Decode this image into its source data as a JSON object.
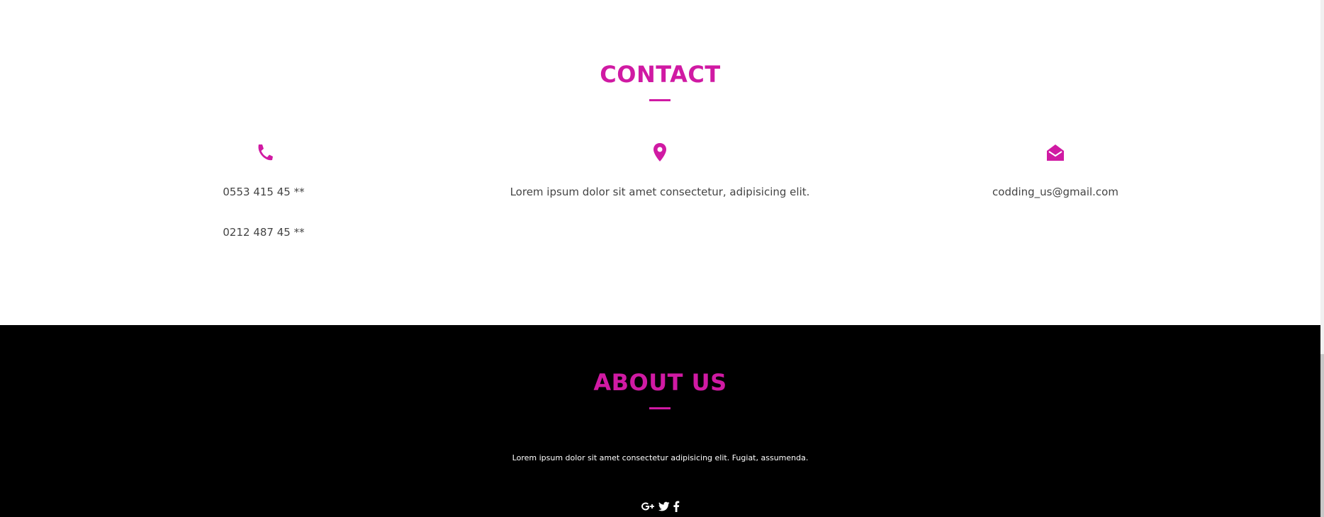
{
  "colors": {
    "accent": "#d01aa3",
    "text": "#444444",
    "about_bg": "#000000",
    "about_text": "#ffffff"
  },
  "contact": {
    "title": "CONTACT",
    "phone": {
      "icon": "phone-icon",
      "lines": [
        "0553 415 45 **",
        "0212 487 45 **"
      ]
    },
    "address": {
      "icon": "map-marker-icon",
      "text": "Lorem ipsum dolor sit amet consectetur, adipisicing elit."
    },
    "email": {
      "icon": "envelope-open-icon",
      "text": "codding_us@gmail.com"
    }
  },
  "about": {
    "title": "ABOUT US",
    "text": "Lorem ipsum dolor sit amet consectetur adipisicing elit. Fugiat, assumenda.",
    "socials": [
      "google-plus-icon",
      "twitter-icon",
      "facebook-icon"
    ]
  }
}
